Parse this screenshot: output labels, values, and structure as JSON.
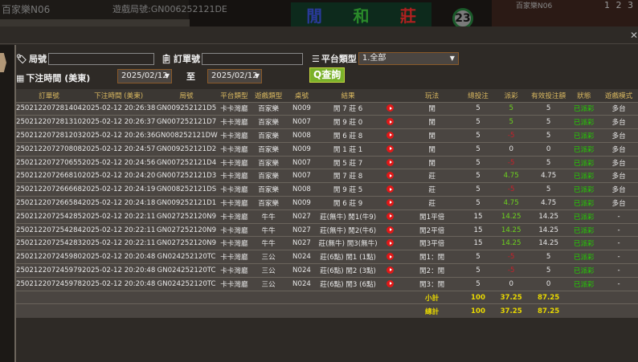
{
  "background": {
    "table_name": "百家樂N06",
    "game_round": "遊戲局號:GN006252121DE",
    "roadmap": [
      "閒",
      "和",
      "莊"
    ],
    "count": "23",
    "video_label": "百家樂N06",
    "video_nums": "1 2 3"
  },
  "filters": {
    "round_label": "局號",
    "round_value": "",
    "order_label": "訂單號",
    "order_value": "",
    "platform_label": "平台類型",
    "platform_value": "1.全部",
    "time_label": "下注時間 (美東)",
    "date_from": "2025/02/12",
    "to_label": "至",
    "date_to": "2025/02/12",
    "search_label": "查詢"
  },
  "columns": [
    "訂單號",
    "下注時間 (美東)",
    "局號",
    "平台類型",
    "遊戲類型",
    "桌號",
    "結果",
    "",
    "玩法",
    "總投注",
    "派彩",
    "有效投注額",
    "狀態",
    "遊戲模式"
  ],
  "rows": [
    [
      "250212207281404",
      "2025-02-12 20:26:38",
      "GN009252121D5",
      "卡卡灣廳",
      "百家樂",
      "N009",
      "閒 7 莊 6",
      "閒",
      "5",
      "5",
      "5",
      "已派彩",
      "多台"
    ],
    [
      "250212207281310",
      "2025-02-12 20:26:37",
      "GN007252121D7",
      "卡卡灣廳",
      "百家樂",
      "N007",
      "閒 9 莊 0",
      "閒",
      "5",
      "5",
      "5",
      "已派彩",
      "多台"
    ],
    [
      "250212207281203",
      "2025-02-12 20:26:36",
      "GN008252121DW",
      "卡卡灣廳",
      "百家樂",
      "N008",
      "閒 6 莊 8",
      "閒",
      "5",
      "-5",
      "5",
      "已派彩",
      "多台"
    ],
    [
      "250212207270808",
      "2025-02-12 20:24:57",
      "GN009252121D2",
      "卡卡灣廳",
      "百家樂",
      "N009",
      "閒 1 莊 1",
      "閒",
      "5",
      "0",
      "0",
      "已派彩",
      "多台"
    ],
    [
      "250212207270655",
      "2025-02-12 20:24:56",
      "GN007252121D4",
      "卡卡灣廳",
      "百家樂",
      "N007",
      "閒 5 莊 7",
      "閒",
      "5",
      "-5",
      "5",
      "已派彩",
      "多台"
    ],
    [
      "250212207266810",
      "2025-02-12 20:24:20",
      "GN007252121D3",
      "卡卡灣廳",
      "百家樂",
      "N007",
      "閒 7 莊 8",
      "莊",
      "5",
      "4.75",
      "4.75",
      "已派彩",
      "多台"
    ],
    [
      "250212207266668",
      "2025-02-12 20:24:19",
      "GN008252121DS",
      "卡卡灣廳",
      "百家樂",
      "N008",
      "閒 9 莊 5",
      "莊",
      "5",
      "-5",
      "5",
      "已派彩",
      "多台"
    ],
    [
      "250212207266584",
      "2025-02-12 20:24:18",
      "GN009252121D1",
      "卡卡灣廳",
      "百家樂",
      "N009",
      "閒 6 莊 9",
      "莊",
      "5",
      "4.75",
      "4.75",
      "已派彩",
      "多台"
    ],
    [
      "250212207254285",
      "2025-02-12 20:22:11",
      "GN027252120N9",
      "卡卡灣廳",
      "牛牛",
      "N027",
      "莊(無牛) 閒1(牛9)",
      "閒1平倍",
      "15",
      "14.25",
      "14.25",
      "已派彩",
      "-"
    ],
    [
      "250212207254284",
      "2025-02-12 20:22:11",
      "GN027252120N9",
      "卡卡灣廳",
      "牛牛",
      "N027",
      "莊(無牛) 閒2(牛6)",
      "閒2平倍",
      "15",
      "14.25",
      "14.25",
      "已派彩",
      "-"
    ],
    [
      "250212207254283",
      "2025-02-12 20:22:11",
      "GN027252120N9",
      "卡卡灣廳",
      "牛牛",
      "N027",
      "莊(無牛) 閒3(無牛)",
      "閒3平倍",
      "15",
      "14.25",
      "14.25",
      "已派彩",
      "-"
    ],
    [
      "250212207245980",
      "2025-02-12 20:20:48",
      "GN024252120TC",
      "卡卡灣廳",
      "三公",
      "N024",
      "莊(6點) 閒1 (1點)",
      "閒1：閒",
      "5",
      "-5",
      "5",
      "已派彩",
      "-"
    ],
    [
      "250212207245979",
      "2025-02-12 20:20:48",
      "GN024252120TC",
      "卡卡灣廳",
      "三公",
      "N024",
      "莊(6點) 閒2 (3點)",
      "閒2：閒",
      "5",
      "-5",
      "5",
      "已派彩",
      "-"
    ],
    [
      "250212207245978",
      "2025-02-12 20:20:48",
      "GN024252120TC",
      "卡卡灣廳",
      "三公",
      "N024",
      "莊(6點) 閒3 (6點)",
      "閒3：閒",
      "5",
      "0",
      "0",
      "已派彩",
      "-"
    ]
  ],
  "subtotal": {
    "label": "小計",
    "bet": "100",
    "payout": "37.25",
    "valid": "87.25"
  },
  "total": {
    "label": "總計",
    "bet": "100",
    "payout": "37.25",
    "valid": "87.25"
  },
  "colors": {
    "positive": "#6cd21e",
    "negative": "#c8202a",
    "status": "#22d000",
    "header": "#d9b860",
    "summary": "#e8d800"
  }
}
